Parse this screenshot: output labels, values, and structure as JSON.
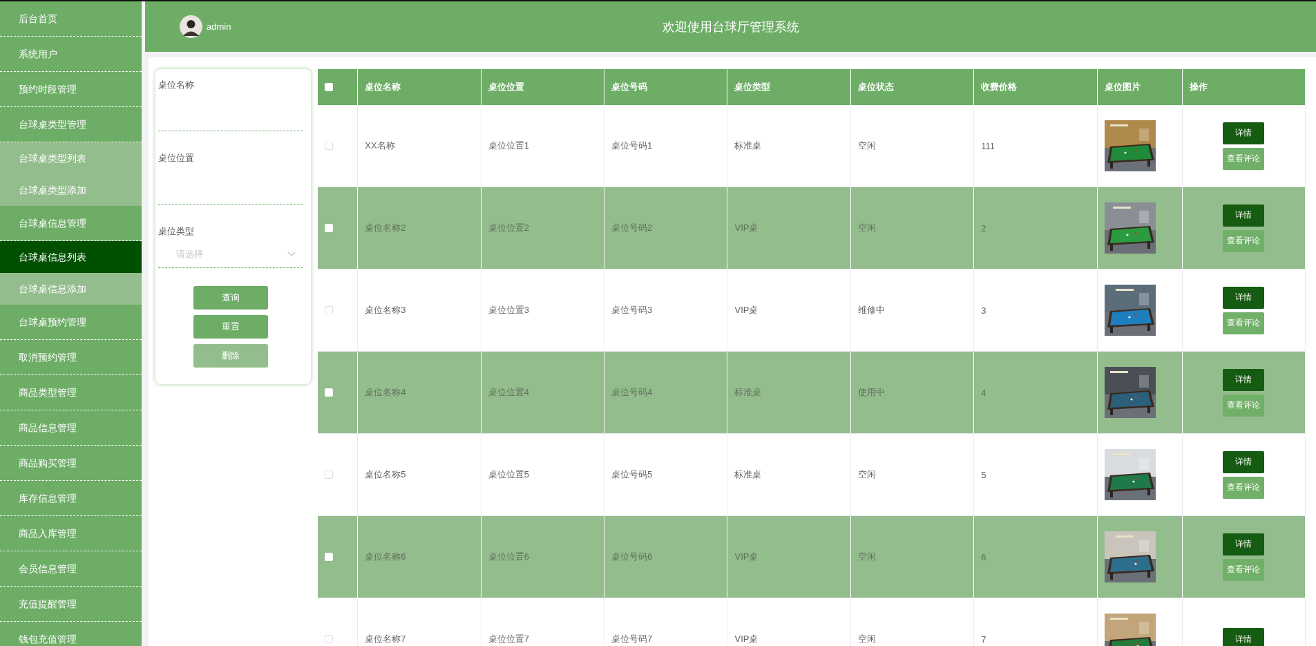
{
  "sidebar": {
    "items": [
      {
        "label": "后台首页",
        "kind": "menu",
        "selected": false
      },
      {
        "label": "系统用户",
        "kind": "menu",
        "selected": false
      },
      {
        "label": "预约时段管理",
        "kind": "menu",
        "selected": false
      },
      {
        "label": "台球桌类型管理",
        "kind": "menu",
        "selected": false
      },
      {
        "label": "台球桌类型列表",
        "kind": "sub",
        "selected": false
      },
      {
        "label": "台球桌类型添加",
        "kind": "sub",
        "selected": false
      },
      {
        "label": "台球桌信息管理",
        "kind": "menu",
        "selected": false
      },
      {
        "label": "台球桌信息列表",
        "kind": "sub",
        "selected": true
      },
      {
        "label": "台球桌信息添加",
        "kind": "sub",
        "selected": false
      },
      {
        "label": "台球桌预约管理",
        "kind": "menu",
        "selected": false
      },
      {
        "label": "取消预约管理",
        "kind": "menu",
        "selected": false
      },
      {
        "label": "商品类型管理",
        "kind": "menu",
        "selected": false
      },
      {
        "label": "商品信息管理",
        "kind": "menu",
        "selected": false
      },
      {
        "label": "商品购买管理",
        "kind": "menu",
        "selected": false
      },
      {
        "label": "库存信息管理",
        "kind": "menu",
        "selected": false
      },
      {
        "label": "商品入库管理",
        "kind": "menu",
        "selected": false
      },
      {
        "label": "会员信息管理",
        "kind": "menu",
        "selected": false
      },
      {
        "label": "充值提醒管理",
        "kind": "menu",
        "selected": false
      },
      {
        "label": "钱包充值管理",
        "kind": "menu",
        "selected": false
      }
    ]
  },
  "header": {
    "user": "admin",
    "title": "欢迎使用台球厅管理系统"
  },
  "filter": {
    "fields": [
      {
        "label": "桌位名称",
        "kind": "text"
      },
      {
        "label": "桌位位置",
        "kind": "text"
      },
      {
        "label": "桌位类型",
        "kind": "select",
        "placeholder": "请选择"
      }
    ],
    "buttons": [
      {
        "label": "查询",
        "kind": "primary"
      },
      {
        "label": "重置",
        "kind": "primary"
      },
      {
        "label": "删除",
        "kind": "muted"
      }
    ]
  },
  "table": {
    "columns": [
      "桌位名称",
      "桌位位置",
      "桌位号码",
      "桌位类型",
      "桌位状态",
      "收费价格",
      "桌位图片",
      "操作"
    ],
    "all_checked": false,
    "rows": [
      {
        "checked": false,
        "cells": [
          "XX名称",
          "桌位位置1",
          "桌位号码1",
          "标准桌",
          "空闲",
          "111"
        ],
        "picture": {
          "kind": "picture"
        },
        "actions": [
          "详情",
          "查看评论"
        ]
      },
      {
        "checked": false,
        "cells": [
          "桌位名称2",
          "桌位位置2",
          "桌位号码2",
          "VIP桌",
          "空闲",
          "2"
        ],
        "picture": {
          "kind": "picture"
        },
        "actions": [
          "详情",
          "查看评论"
        ]
      },
      {
        "checked": false,
        "cells": [
          "桌位名称3",
          "桌位位置3",
          "桌位号码3",
          "VIP桌",
          "维修中",
          "3"
        ],
        "picture": {
          "kind": "picture"
        },
        "actions": [
          "详情",
          "查看评论"
        ]
      },
      {
        "checked": false,
        "cells": [
          "桌位名称4",
          "桌位位置4",
          "桌位号码4",
          "标准桌",
          "使用中",
          "4"
        ],
        "picture": {
          "kind": "picture"
        },
        "actions": [
          "详情",
          "查看评论"
        ]
      },
      {
        "checked": false,
        "cells": [
          "桌位名称5",
          "桌位位置5",
          "桌位号码5",
          "标准桌",
          "空闲",
          "5"
        ],
        "picture": {
          "kind": "picture"
        },
        "actions": [
          "详情",
          "查看评论"
        ]
      },
      {
        "checked": false,
        "cells": [
          "桌位名称6",
          "桌位位置6",
          "桌位号码6",
          "VIP桌",
          "空闲",
          "6"
        ],
        "picture": {
          "kind": "picture"
        },
        "actions": [
          "详情",
          "查看评论"
        ]
      },
      {
        "checked": false,
        "cells": [
          "桌位名称7",
          "桌位位置7",
          "桌位号码7",
          "VIP桌",
          "空闲",
          "7"
        ],
        "picture": {
          "kind": "picture"
        },
        "actions": [
          "详情"
        ]
      }
    ]
  }
}
